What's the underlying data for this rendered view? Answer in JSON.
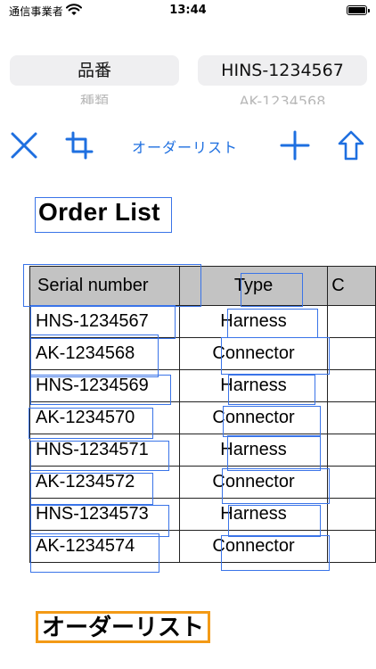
{
  "status_bar": {
    "carrier": "通信事業者",
    "time": "13:44"
  },
  "pickers": {
    "left": {
      "selected": "品番",
      "next": "種類"
    },
    "right": {
      "selected": "HINS-1234567",
      "next": "AK-1234568"
    }
  },
  "toolbar": {
    "title": "オーダーリスト",
    "icons": [
      "close-icon",
      "crop-icon",
      "plus-icon",
      "share-icon"
    ],
    "accent_color": "#1e6fe0"
  },
  "document": {
    "title": "Order List",
    "table": {
      "headers": [
        "Serial number",
        "Type",
        "C"
      ],
      "rows": [
        {
          "serial": "HNS-1234567",
          "type": "Harness"
        },
        {
          "serial": "AK-1234568",
          "type": "Connector"
        },
        {
          "serial": "HNS-1234569",
          "type": "Harness"
        },
        {
          "serial": "AK-1234570",
          "type": "Connector"
        },
        {
          "serial": "HNS-1234571",
          "type": "Harness"
        },
        {
          "serial": "AK-1234572",
          "type": "Connector"
        },
        {
          "serial": "HNS-1234573",
          "type": "Harness"
        },
        {
          "serial": "AK-1234574",
          "type": "Connector"
        }
      ]
    },
    "footer_title": "オーダーリスト",
    "highlight_colors": {
      "detected": "#3a74e8",
      "selected": "#f39a16"
    }
  }
}
